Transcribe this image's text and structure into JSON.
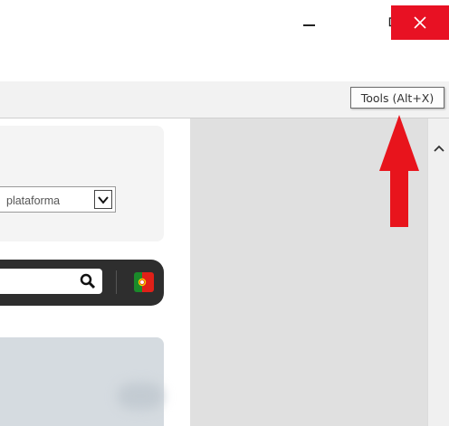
{
  "window": {
    "minimize_icon": "minimize-icon",
    "restore_icon": "restore-icon",
    "close_icon": "close-icon",
    "close_color": "#e81123"
  },
  "toolbar": {
    "icons": [
      "home-icon",
      "favorites-star-icon",
      "tools-gear-icon",
      "smiley-feedback-icon"
    ],
    "gear_color": "#1e88d6",
    "smiley_color": "#f2c200"
  },
  "tooltip": {
    "text": "Tools (Alt+X)"
  },
  "page": {
    "select_value": "plataforma",
    "search_icon": "search-icon",
    "flag_icon": "portugal-flag-icon"
  },
  "annotation": {
    "arrow_color": "#e8141c"
  }
}
